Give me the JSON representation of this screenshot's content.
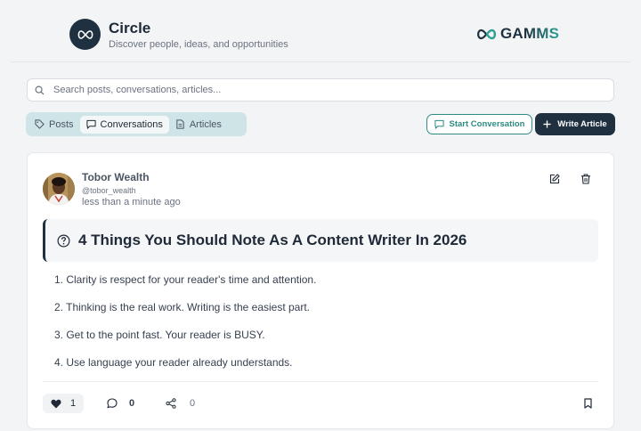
{
  "header": {
    "app_title": "Circle",
    "app_subtitle": "Discover people, ideas, and opportunities",
    "brand_text": "GAMMS",
    "logo_icon": "infinity-icon"
  },
  "search": {
    "placeholder": "Search posts, conversations, articles...",
    "value": ""
  },
  "tabs": [
    {
      "label": "Posts",
      "icon": "tag-icon",
      "active": false
    },
    {
      "label": "Conversations",
      "icon": "message-square-icon",
      "active": true
    },
    {
      "label": "Articles",
      "icon": "file-text-icon",
      "active": false
    }
  ],
  "actions": {
    "start_conversation": "Start Conversation",
    "write_article": "Write Article"
  },
  "post": {
    "author_name": "Tobor Wealth",
    "author_handle": "@tobor_wealth",
    "time": "less than a minute ago",
    "title": "4 Things You Should Note As A Content Writer In 2026",
    "items": [
      "1. Clarity is respect for your reader's time and attention.",
      "2. Thinking is the real work. Writing is the easiest part.",
      "3. Get to the point fast. Your reader is BUSY.",
      "4. Use language your reader already understands."
    ],
    "likes": "1",
    "comments": "0",
    "shares": "0"
  },
  "colors": {
    "primary_dark": "#1f3140",
    "accent_teal": "#2e8b84",
    "tab_bg": "#cfe4e6",
    "page_bg": "#f3f4f6"
  }
}
